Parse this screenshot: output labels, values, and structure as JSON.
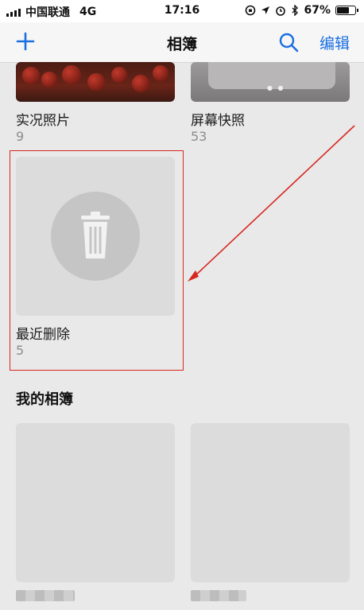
{
  "status_bar": {
    "carrier": "中国联通",
    "network": "4G",
    "time": "17:16",
    "battery": "67%"
  },
  "nav": {
    "title": "相簿",
    "edit_label": "编辑"
  },
  "albums": [
    {
      "name": "实况照片",
      "count": "9"
    },
    {
      "name": "屏幕快照",
      "count": "53"
    },
    {
      "name": "最近删除",
      "count": "5"
    }
  ],
  "my_albums_title": "我的相簿",
  "colors": {
    "accent": "#1a6fe0",
    "highlight": "#d7271f"
  }
}
